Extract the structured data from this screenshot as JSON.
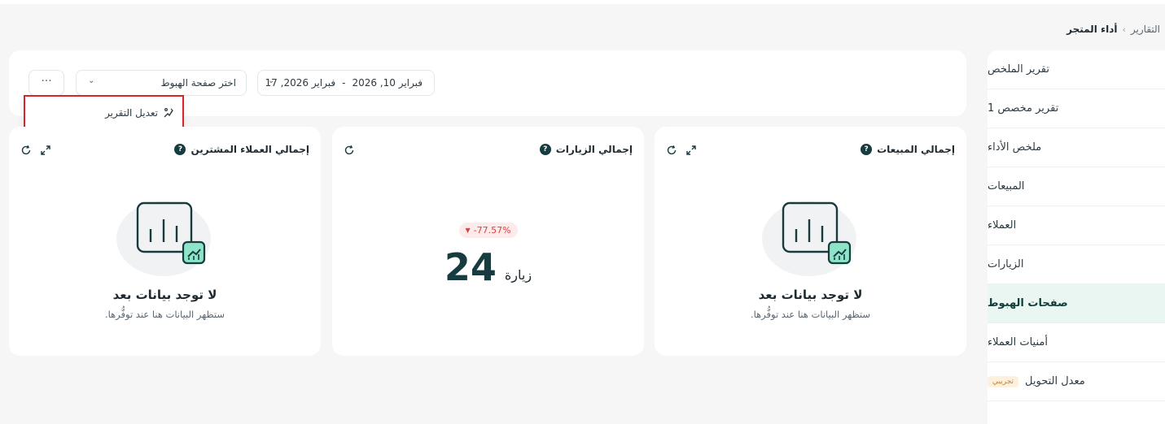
{
  "breadcrumb": {
    "parent": "التقارير",
    "current": "أداء المتجر"
  },
  "sidebar": {
    "items": [
      {
        "label": "تقرير الملخص"
      },
      {
        "label": "تقرير مخصص 1"
      },
      {
        "label": "ملخص الأداء"
      },
      {
        "label": "المبيعات"
      },
      {
        "label": "العملاء"
      },
      {
        "label": "الزيارات"
      },
      {
        "label": "صفحات الهبوط",
        "active": true
      },
      {
        "label": "أمنيات العملاء"
      },
      {
        "label": "معدل التحويل",
        "badge": "تجريبي"
      }
    ]
  },
  "filters": {
    "date_start": "فبراير 10, 2026",
    "date_sep": "-",
    "date_end": "فبراير 2026, 17",
    "landing_placeholder": "اختر صفحة الهبوط",
    "more_label": "···"
  },
  "dropdown": {
    "edit_report": "تعديل التقرير"
  },
  "cards": {
    "sales": {
      "title": "إجمالي المبيعات",
      "empty_title": "لا توجد بيانات بعد",
      "empty_sub": "ستظهر البيانات هنا عند توفُّرها."
    },
    "visits": {
      "title": "إجمالي الزيارات",
      "change": "-77.57%",
      "value": "24",
      "unit": "زيارة"
    },
    "customers": {
      "title": "إجمالي العملاء المشترين",
      "empty_title": "لا توجد بيانات بعد",
      "empty_sub": "ستظهر البيانات هنا عند توفُّرها."
    }
  },
  "colors": {
    "accent": "#173c3f",
    "active_bg": "#eaf6f1",
    "highlight_border": "#d9252a",
    "negative": "#d94242",
    "illus_mint": "#8ee4c9"
  }
}
